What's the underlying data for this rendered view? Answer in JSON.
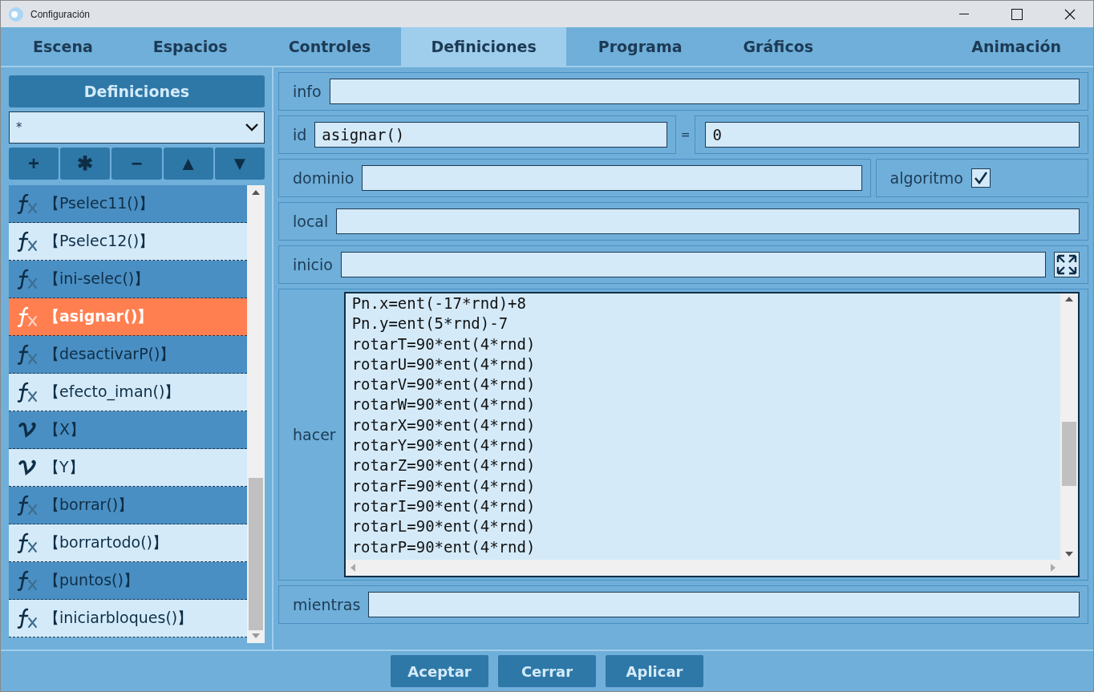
{
  "window": {
    "title": "Configuración"
  },
  "tabs": [
    {
      "label": "Escena",
      "selected": false
    },
    {
      "label": "Espacios",
      "selected": false
    },
    {
      "label": "Controles",
      "selected": false
    },
    {
      "label": "Definiciones",
      "selected": true
    },
    {
      "label": "Programa",
      "selected": false
    },
    {
      "label": "Gráficos",
      "selected": false
    },
    {
      "label": "Animación",
      "selected": false
    }
  ],
  "sidebar": {
    "title": "Definiciones",
    "filter": {
      "value": "*"
    },
    "tools": [
      "+",
      "✱",
      "−",
      "▲",
      "▼"
    ],
    "items": [
      {
        "kind": "function",
        "label": "【Pselec11()】",
        "selected": false
      },
      {
        "kind": "function",
        "label": "【Pselec12()】",
        "selected": false
      },
      {
        "kind": "function",
        "label": "【ini-selec()】",
        "selected": false
      },
      {
        "kind": "function",
        "label": "【asignar()】",
        "selected": true
      },
      {
        "kind": "function",
        "label": "【desactivarP()】",
        "selected": false
      },
      {
        "kind": "function",
        "label": "【efecto_iman()】",
        "selected": false
      },
      {
        "kind": "variable",
        "label": "【X】",
        "selected": false
      },
      {
        "kind": "variable",
        "label": "【Y】",
        "selected": false
      },
      {
        "kind": "function",
        "label": "【borrar()】",
        "selected": false
      },
      {
        "kind": "function",
        "label": "【borrartodo()】",
        "selected": false
      },
      {
        "kind": "function",
        "label": "【puntos()】",
        "selected": false
      },
      {
        "kind": "function",
        "label": "【iniciarbloques()】",
        "selected": false
      }
    ]
  },
  "form": {
    "info": {
      "label": "info"
    },
    "id": {
      "label": "id",
      "value": "asignar()",
      "equals": "=",
      "result": "0"
    },
    "dominio": {
      "label": "dominio"
    },
    "algoritmo": {
      "label": "algoritmo",
      "checked": true
    },
    "local": {
      "label": "local"
    },
    "inicio": {
      "label": "inicio"
    },
    "hacer": {
      "label": "hacer",
      "lines": [
        "Pn.x=ent(-17*rnd)+8",
        "Pn.y=ent(5*rnd)-7",
        "rotarT=90*ent(4*rnd)",
        "rotarU=90*ent(4*rnd)",
        "rotarV=90*ent(4*rnd)",
        "rotarW=90*ent(4*rnd)",
        "rotarX=90*ent(4*rnd)",
        "rotarY=90*ent(4*rnd)",
        "rotarZ=90*ent(4*rnd)",
        "rotarF=90*ent(4*rnd)",
        "rotarI=90*ent(4*rnd)",
        "rotarL=90*ent(4*rnd)",
        "rotarP=90*ent(4*rnd)"
      ]
    },
    "mientras": {
      "label": "mientras"
    }
  },
  "buttons": [
    "Aceptar",
    "Cerrar",
    "Aplicar"
  ]
}
